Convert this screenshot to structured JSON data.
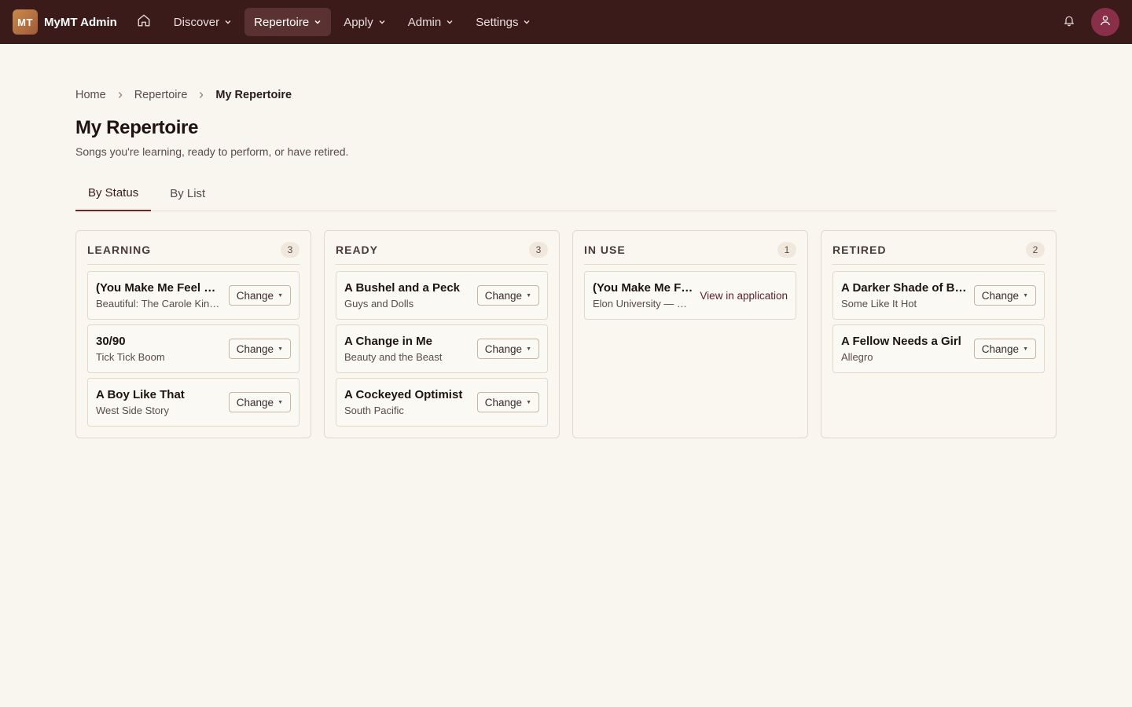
{
  "nav": {
    "logo_initials": "MT",
    "brand": "MyMT Admin",
    "items": [
      {
        "label": "Discover",
        "active": false
      },
      {
        "label": "Repertoire",
        "active": true
      },
      {
        "label": "Apply",
        "active": false
      },
      {
        "label": "Admin",
        "active": false
      },
      {
        "label": "Settings",
        "active": false
      }
    ],
    "icons": [
      "home-icon",
      "bell-icon",
      "user-icon",
      "chevron-down-icon"
    ]
  },
  "breadcrumb": [
    "Home",
    "Repertoire",
    "My Repertoire"
  ],
  "page": {
    "title": "My Repertoire",
    "subtitle": "Songs you're learning, ready to perform, or have retired."
  },
  "tabs": [
    {
      "label": "By Status",
      "active": true
    },
    {
      "label": "By List",
      "active": false
    }
  ],
  "columns": [
    {
      "title": "LEARNING",
      "count": "3",
      "cards": [
        {
          "title": "(You Make Me Feel Like) A Natural Woman",
          "subtitle": "Beautiful: The Carole King Musical",
          "action": "Change"
        },
        {
          "title": "30/90",
          "subtitle": "Tick Tick Boom",
          "action": "Change"
        },
        {
          "title": "A Boy Like That",
          "subtitle": "West Side Story",
          "action": "Change"
        }
      ]
    },
    {
      "title": "READY",
      "count": "3",
      "cards": [
        {
          "title": "A Bushel and a Peck",
          "subtitle": "Guys and Dolls",
          "action": "Change"
        },
        {
          "title": "A Change in Me",
          "subtitle": "Beauty and the Beast",
          "action": "Change"
        },
        {
          "title": "A Cockeyed Optimist",
          "subtitle": "South Pacific",
          "action": "Change"
        }
      ]
    },
    {
      "title": "IN USE",
      "count": "1",
      "cards": [
        {
          "title": "(You Make Me Feel Like) A Natural Woman",
          "subtitle": "Elon University — Musical Theatre",
          "link": "View in application"
        }
      ]
    },
    {
      "title": "RETIRED",
      "count": "2",
      "cards": [
        {
          "title": "A Darker Shade of Blue",
          "subtitle": "Some Like It Hot",
          "action": "Change"
        },
        {
          "title": "A Fellow Needs a Girl",
          "subtitle": "Allegro",
          "action": "Change"
        }
      ]
    }
  ],
  "colors": {
    "navbar": "#3b1a1a",
    "background": "#f9f6f0",
    "accent": "#6b2a2a",
    "avatar": "#8a2f4a"
  }
}
